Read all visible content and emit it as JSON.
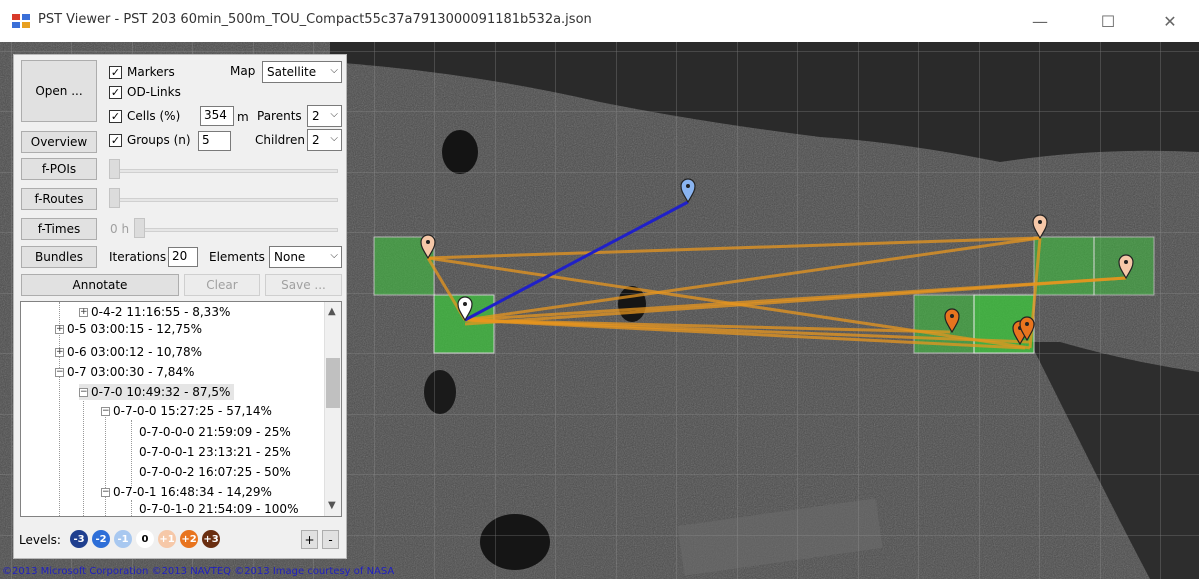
{
  "window": {
    "title": "PST Viewer - PST 203 60min_500m_TOU_Compact55c37a7913000091181b532a.json",
    "minimize": "—",
    "maximize": "☐",
    "close": "✕"
  },
  "panel": {
    "open_label": "Open ...",
    "overview_label": "Overview",
    "fpois_label": "f-POIs",
    "froutes_label": "f-Routes",
    "ftimes_label": "f-Times",
    "ftimes_value": "0 h",
    "bundles_label": "Bundles",
    "annotate_label": "Annotate",
    "clear_label": "Clear",
    "save_label": "Save ...",
    "markers": {
      "label": "Markers",
      "checked": true
    },
    "odlinks": {
      "label": "OD-Links",
      "checked": true
    },
    "cells": {
      "label": "Cells (%)",
      "checked": true,
      "value": "354",
      "unit": "m"
    },
    "groups": {
      "label": "Groups (n)",
      "checked": true,
      "value": "5"
    },
    "map_label": "Map",
    "map_value": "Satellite",
    "parents_label": "Parents",
    "parents_value": "2",
    "children_label": "Children",
    "children_value": "2",
    "iterations_label": "Iterations",
    "iterations_value": "20",
    "elements_label": "Elements",
    "elements_value": "None",
    "check_mark": "✓",
    "dropdown_arrow": "⌵"
  },
  "tree": {
    "rows": [
      {
        "text": "0-4-2  11:16:55 - 8,33%",
        "expander": "+",
        "selected": false
      },
      {
        "text": "0-5  03:00:15 - 12,75%",
        "expander": "+",
        "selected": false
      },
      {
        "text": "0-6  03:00:12 - 10,78%",
        "expander": "+",
        "selected": false
      },
      {
        "text": "0-7  03:00:30 - 7,84%",
        "expander": "−",
        "selected": false
      },
      {
        "text": "0-7-0  10:49:32 - 87,5%",
        "expander": "−",
        "selected": true
      },
      {
        "text": "0-7-0-0  15:27:25 - 57,14%",
        "expander": "−",
        "selected": false
      },
      {
        "text": "0-7-0-0-0  21:59:09 - 25%",
        "expander": "",
        "selected": false
      },
      {
        "text": "0-7-0-0-1  23:13:21 - 25%",
        "expander": "",
        "selected": false
      },
      {
        "text": "0-7-0-0-2  16:07:25 - 50%",
        "expander": "",
        "selected": false
      },
      {
        "text": "0-7-0-1  16:48:34 - 14,29%",
        "expander": "−",
        "selected": false
      },
      {
        "text": "0-7-0-1-0  21:54:09 - 100%",
        "expander": "",
        "selected": false
      }
    ],
    "scroll_up": "▲",
    "scroll_down": "▼"
  },
  "levels": {
    "label": "Levels:",
    "items": [
      {
        "text": "-3",
        "color": "#1f3f8f"
      },
      {
        "text": "-2",
        "color": "#2e6fd8"
      },
      {
        "text": "-1",
        "color": "#a8c8f0"
      },
      {
        "text": "0",
        "color": "#ffffff"
      },
      {
        "text": "+1",
        "color": "#f6c8a8"
      },
      {
        "text": "+2",
        "color": "#e8741e"
      },
      {
        "text": "+3",
        "color": "#6a2e10"
      }
    ],
    "plus": "+",
    "minus": "-"
  },
  "map": {
    "copyright": "©2013 Microsoft Corporation  ©2013 NAVTEQ  ©2013 Image courtesy of NASA",
    "link_color": "#e8961e",
    "od_link_color": "#2020c8",
    "cell_color": "#3cc83c"
  }
}
